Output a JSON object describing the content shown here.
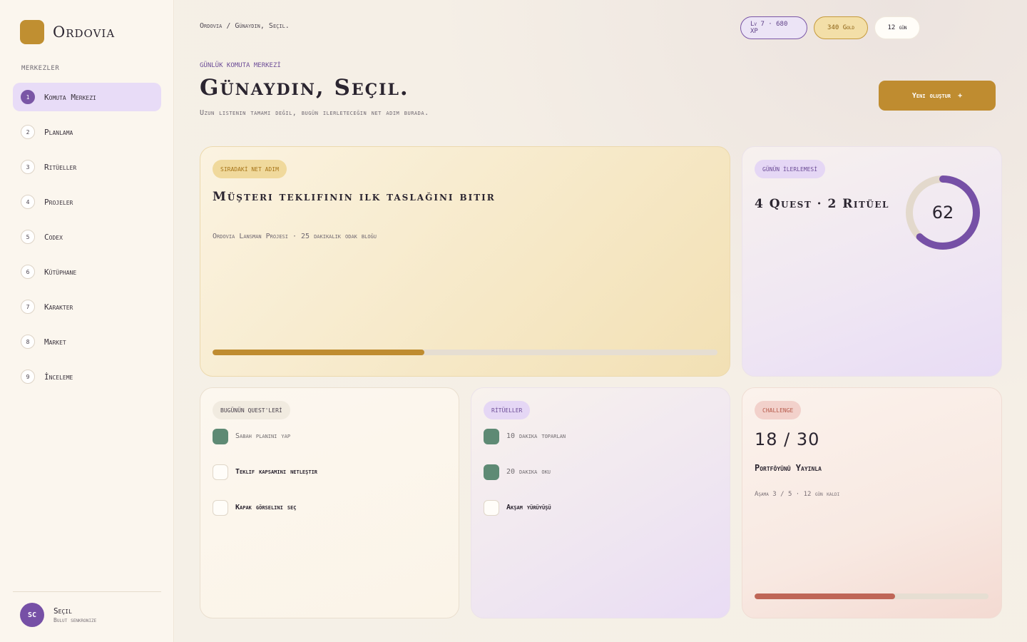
{
  "brand": {
    "name": "Ordovia"
  },
  "sidebar": {
    "section_label": "MERKEZLER",
    "items": [
      {
        "num": "1",
        "label": "Komuta Merkezi",
        "active": true
      },
      {
        "num": "2",
        "label": "Planlama"
      },
      {
        "num": "3",
        "label": "Ritüeller"
      },
      {
        "num": "4",
        "label": "Projeler"
      },
      {
        "num": "5",
        "label": "Codex"
      },
      {
        "num": "6",
        "label": "Kütüphane"
      },
      {
        "num": "7",
        "label": "Karakter"
      },
      {
        "num": "8",
        "label": "Market"
      },
      {
        "num": "9",
        "label": "İnceleme"
      }
    ],
    "user": {
      "initials": "SC",
      "name": "Seçil",
      "status": "Bulut senkronize"
    }
  },
  "header": {
    "breadcrumb": "Ordovia / Günaydın, Seçil.",
    "stats": {
      "xp": "Lv 7 · 680 XP",
      "gold": "340 Gold",
      "days": "12 gün"
    },
    "eyebrow": "GÜNLÜK KOMUTA MERKEZİ",
    "title": "Günaydın, Seçil.",
    "subtitle": "Uzun listenin tamamı değil, bugün ilerleteceğin net adım burada.",
    "new_button": "Yeni oluştur",
    "new_button_icon": "+"
  },
  "next_step": {
    "tag": "SIRADAKİ NET ADIM",
    "title": "Müşteri teklifinin ilk taslağını bitir",
    "meta": "Ordovia Lansman Projesi · 25 dakikalık odak bloğu",
    "progress": 0.42
  },
  "progress": {
    "tag": "GÜNÜN İLERLEMESİ",
    "summary": "4 Quest · 2 Ritüel",
    "percent": 62,
    "colors": {
      "track": "#e3d9cc",
      "fill": "#7650a6"
    }
  },
  "quests": {
    "tag": "BUGÜNÜN QUEST'LERİ",
    "items": [
      {
        "label": "Sabah planını yap",
        "done": true
      },
      {
        "label": "Teklif kapsamını netleştir",
        "done": false
      },
      {
        "label": "Kapak görselini seç",
        "done": false
      }
    ]
  },
  "rituals": {
    "tag": "RİTÜELLER",
    "items": [
      {
        "label": "10 dakika toparlan",
        "done": true
      },
      {
        "label": "20 dakika oku",
        "done": true
      },
      {
        "label": "Akşam yürüyüşü",
        "done": false
      }
    ]
  },
  "challenge": {
    "tag": "CHALLENGE",
    "count": "18 / 30",
    "title": "Portföyünü Yayınla",
    "meta": "Aşama 3 / 5 · 12 gün kaldı",
    "progress": 0.6
  }
}
